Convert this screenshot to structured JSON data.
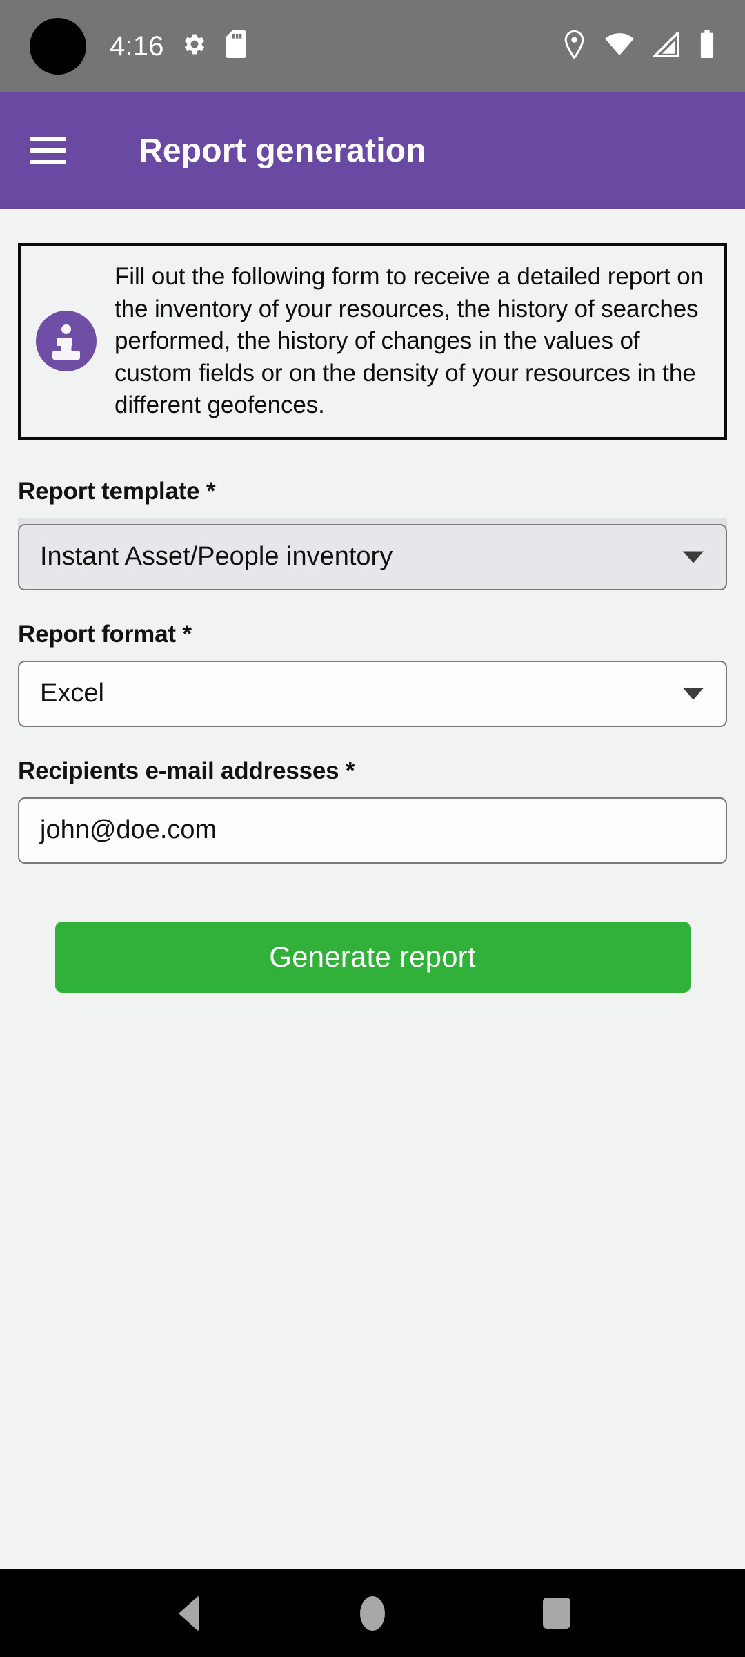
{
  "status_bar": {
    "time": "4:16",
    "left_icons": [
      "settings-gear-icon",
      "sd-card-icon"
    ],
    "right_icons": [
      "location-pin-icon",
      "wifi-icon",
      "cellular-signal-icon",
      "battery-icon"
    ],
    "background_color": "#757575"
  },
  "app_bar": {
    "menu_icon": "hamburger-menu-icon",
    "title": "Report generation",
    "background_color": "#6A49A3",
    "text_color": "#FFFFFF"
  },
  "info_callout": {
    "icon": "info-circle-icon",
    "icon_color": "#6F4EA6",
    "border_color": "#0A0A0A",
    "text": "Fill out the following form to receive a detailed report on the inventory of your resources, the history of searches performed, the history of changes in the values of custom fields or on the density of your resources in the different geofences."
  },
  "form": {
    "report_template": {
      "label": "Report template *",
      "value": "Instant Asset/People inventory",
      "caret_icon": "chevron-down-icon",
      "focused": true
    },
    "report_format": {
      "label": "Report format *",
      "value": "Excel",
      "caret_icon": "chevron-down-icon",
      "focused": false
    },
    "recipients": {
      "label": "Recipients e-mail addresses *",
      "value": "john@doe.com",
      "placeholder": "john@doe.com"
    },
    "submit": {
      "label": "Generate report",
      "color": "#31B03A",
      "text_color": "#FFFFFF"
    }
  },
  "nav_bar": {
    "back": "back-triangle-icon",
    "home": "home-circle-icon",
    "recents": "recents-square-icon",
    "background_color": "#000000",
    "icon_color": "#A8A8A8"
  },
  "page": {
    "background_color": "#F1F2F2"
  }
}
